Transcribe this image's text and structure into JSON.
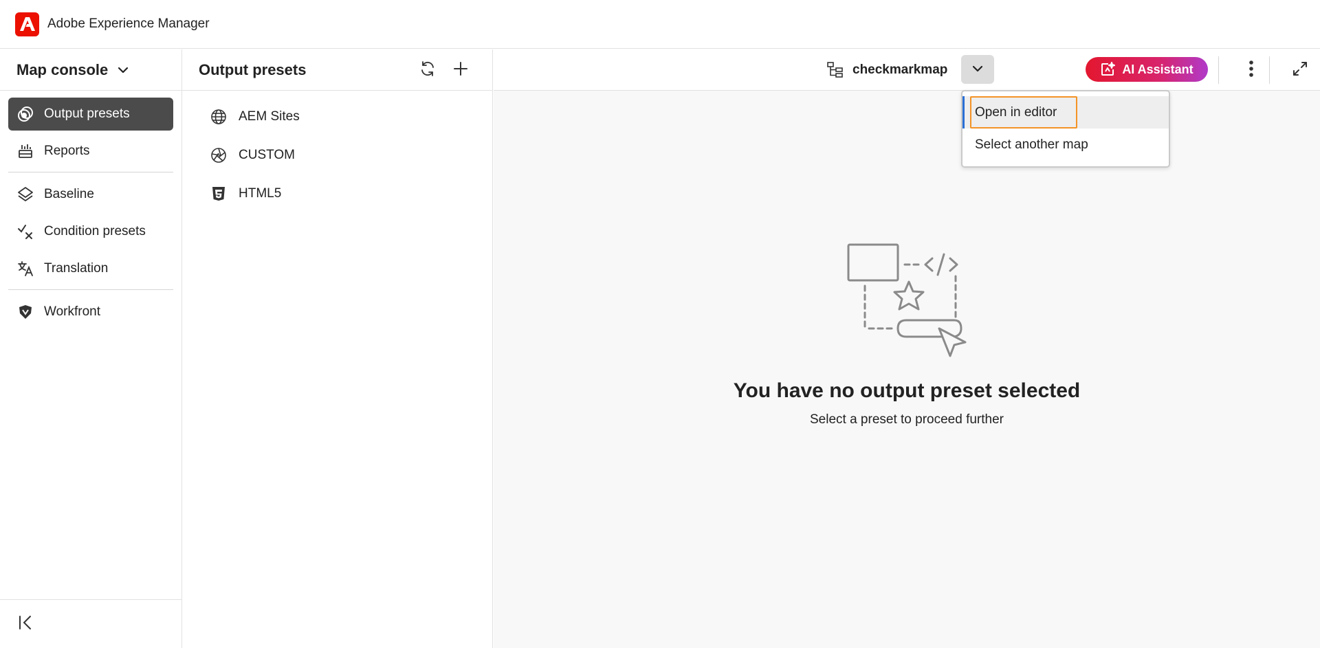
{
  "app": {
    "title": "Adobe Experience Manager",
    "brand_color": "#eb1000"
  },
  "leftnav": {
    "console_title": "Map console",
    "items": [
      {
        "label": "Output presets",
        "icon": "output-presets-icon",
        "active": true
      },
      {
        "label": "Reports",
        "icon": "reports-icon"
      },
      {
        "label": "Baseline",
        "icon": "baseline-icon"
      },
      {
        "label": "Condition presets",
        "icon": "condition-presets-icon"
      },
      {
        "label": "Translation",
        "icon": "translation-icon"
      },
      {
        "label": "Workfront",
        "icon": "workfront-icon"
      }
    ],
    "collapse_icon": "collapse-panel-icon"
  },
  "presets": {
    "title": "Output presets",
    "refresh_icon": "refresh-icon",
    "add_icon": "add-icon",
    "items": [
      {
        "label": "AEM Sites",
        "icon": "globe-icon"
      },
      {
        "label": "CUSTOM",
        "icon": "aperture-icon"
      },
      {
        "label": "HTML5",
        "icon": "html5-icon"
      }
    ]
  },
  "main": {
    "map_name": "checkmarkmap",
    "ai_assistant_label": "AI Assistant",
    "ai_gradient": [
      "#e3172f",
      "#b03ac9"
    ],
    "map_menu": {
      "items": [
        {
          "label": "Open in editor",
          "highlighted": true
        },
        {
          "label": "Select another map"
        }
      ]
    },
    "empty_state": {
      "title": "You have no output preset selected",
      "subtitle": "Select a preset to proceed further"
    }
  }
}
